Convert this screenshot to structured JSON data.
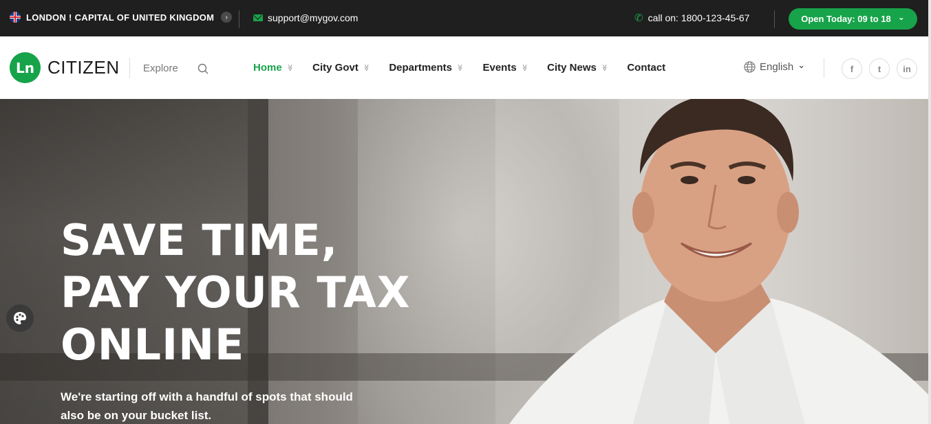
{
  "topbar": {
    "location": "LONDON ! CAPITAL OF UNITED KINGDOM",
    "location_arrow": "›",
    "email": "support@mygov.com",
    "phone": "call on: 1800-123-45-67",
    "open_label": "Open Today: 09 to 18",
    "open_chevron": "⌄"
  },
  "header": {
    "logo_mark": "Ln",
    "logo_text": "CITIZEN",
    "explore": "Explore",
    "nav": [
      {
        "label": "Home",
        "chevron": "≫"
      },
      {
        "label": "City Govt",
        "chevron": "≫"
      },
      {
        "label": "Departments",
        "chevron": "≫"
      },
      {
        "label": "Events",
        "chevron": "≫"
      },
      {
        "label": "City News",
        "chevron": "≫"
      },
      {
        "label": "Contact"
      }
    ],
    "language": "English",
    "language_chevron": "⌄",
    "social": {
      "facebook": "f",
      "twitter": "t",
      "linkedin": "in"
    }
  },
  "hero": {
    "title_line1": "SAVE TIME,",
    "title_line2": "PAY YOUR TAX",
    "title_line3": "ONLINE",
    "subtitle": "We're starting off with a handful of spots that should also be on your bucket list."
  },
  "colors": {
    "accent": "#17a34a",
    "topbar_bg": "#1f1f1f",
    "nav_text": "#222222"
  },
  "icons": [
    "uk-flag-icon",
    "mail-icon",
    "phone-icon",
    "search-icon",
    "globe-icon",
    "facebook-icon",
    "twitter-icon",
    "linkedin-icon",
    "palette-icon"
  ]
}
